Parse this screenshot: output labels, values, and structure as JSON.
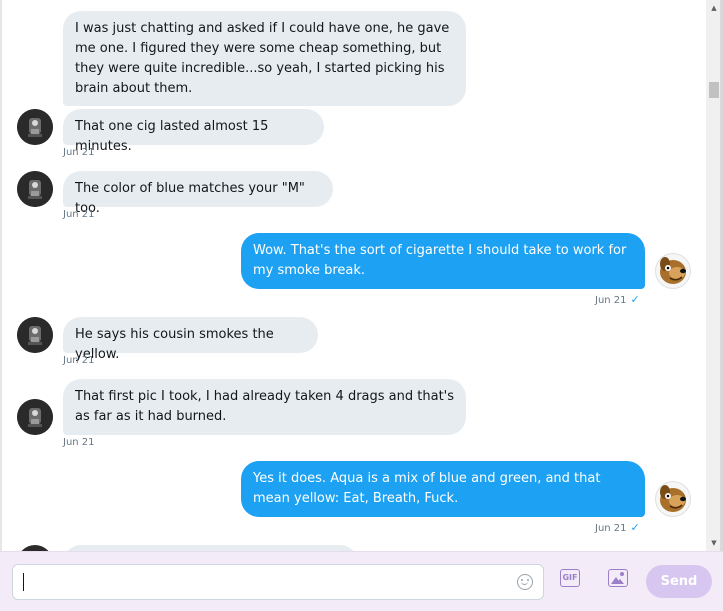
{
  "messages": [
    {
      "text": "I was just chatting and asked if I could have one, he gave me one. I figured they were some cheap something, but they were quite incredible...so yeah, I started picking his brain about them.",
      "time": ""
    },
    {
      "text": "That one cig lasted almost 15 minutes.",
      "time": "Jun 21"
    },
    {
      "text": "The color of blue matches your \"M\" too.",
      "time": "Jun 21"
    },
    {
      "text": "Wow. That's the sort of cigarette I should take to work for my smoke break.",
      "time": "Jun 21",
      "read": "✓"
    },
    {
      "text": "He says his cousin smokes the yellow.",
      "time": "Jun 21"
    },
    {
      "text": "That first pic I took, I had already taken 4 drags and that's as far as it had burned.",
      "time": "Jun 21"
    },
    {
      "text": "Yes it does. Aqua is a mix of blue and green, and that mean yellow: Eat, Breath, Fuck.",
      "time": "Jun 21",
      "read": "✓"
    }
  ],
  "composer": {
    "value": "",
    "gif_label": "GIF",
    "send_label": "Send"
  },
  "colors": {
    "incoming_bubble": "#e6ecf0",
    "outgoing_bubble": "#1da1f2",
    "composer_bg": "#f3ebf7",
    "send_button": "#d7c7f0"
  },
  "icons": [
    "emoji-icon",
    "gif-icon",
    "image-icon",
    "checkmark-icon",
    "avatar-icon"
  ]
}
